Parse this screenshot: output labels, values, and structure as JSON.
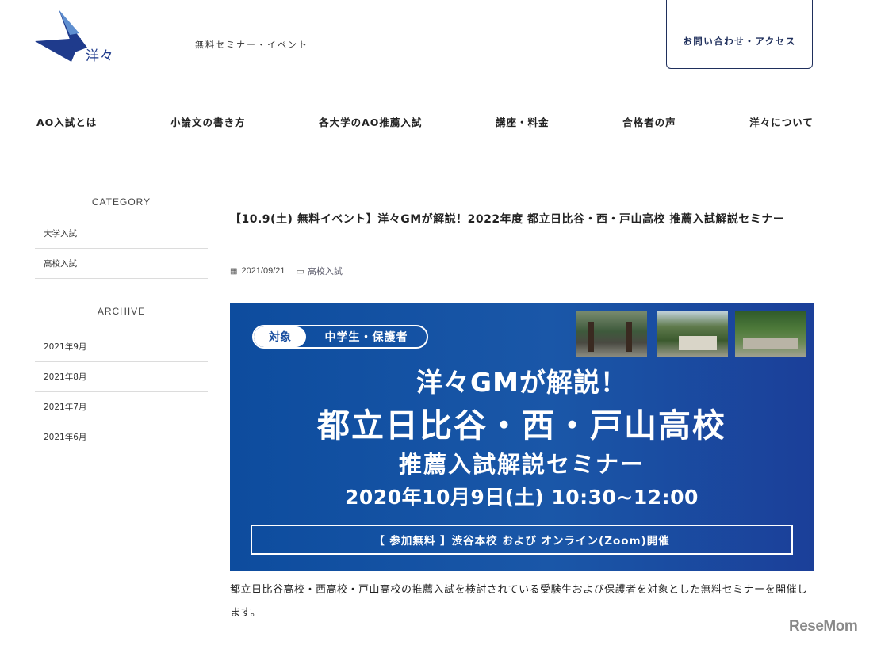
{
  "header": {
    "logo_text": "洋々",
    "seminar_link": "無料セミナー・イベント",
    "contact_button": "お問い合わせ・アクセス"
  },
  "nav": {
    "items": [
      {
        "label": "AO入試とは"
      },
      {
        "label": "小論文の書き方"
      },
      {
        "label": "各大学のAO推薦入試"
      },
      {
        "label": "講座・料金"
      },
      {
        "label": "合格者の声"
      },
      {
        "label": "洋々について"
      }
    ]
  },
  "sidebar": {
    "category_heading": "CATEGORY",
    "categories": [
      {
        "label": "大学入試"
      },
      {
        "label": "高校入試"
      }
    ],
    "archive_heading": "ARCHIVE",
    "archives": [
      {
        "label": "2021年9月"
      },
      {
        "label": "2021年8月"
      },
      {
        "label": "2021年7月"
      },
      {
        "label": "2021年6月"
      }
    ]
  },
  "post": {
    "title": "【10.9(土) 無料イベント】洋々GMが解説！2022年度 都立日比谷・西・戸山高校 推薦入試解説セミナー",
    "date": "2021/09/21",
    "category": "高校入試",
    "body": "都立日比谷高校・西高校・戸山高校の推薦入試を検討されている受験生および保護者を対象とした無料セミナーを開催します。"
  },
  "banner": {
    "target_label": "対象",
    "target_value": "中学生・保護者",
    "line1": "洋々GMが解説！",
    "line2": "都立日比谷・西・戸山高校",
    "line3": "推薦入試解説セミナー",
    "line4": "2020年10月9日(土) 10:30~12:00",
    "box_text": "【 参加無料 】渋谷本校 および オンライン(Zoom)開催"
  },
  "watermark": {
    "text": "ReseMom"
  },
  "colors": {
    "brand_navy": "#1f2f5c",
    "banner_blue": "#1a57a8"
  }
}
